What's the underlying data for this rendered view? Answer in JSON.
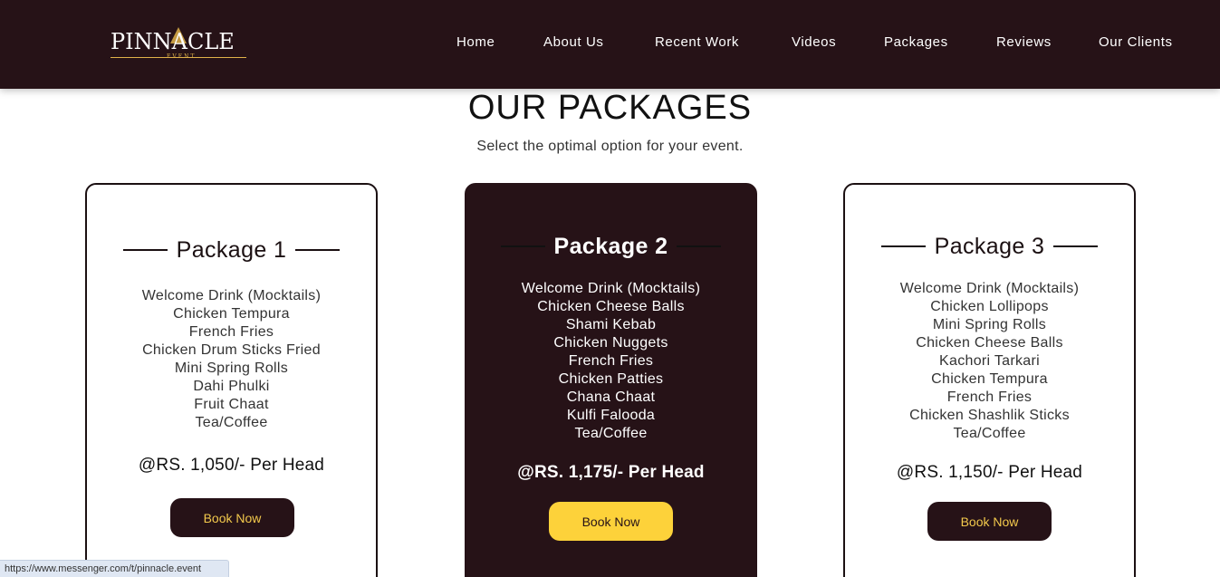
{
  "brand": {
    "logo_text": "PINNACLE",
    "logo_subtext": "EVENT"
  },
  "nav": {
    "items": [
      {
        "label": "Home"
      },
      {
        "label": "About Us"
      },
      {
        "label": "Recent Work"
      },
      {
        "label": "Videos"
      },
      {
        "label": "Packages"
      },
      {
        "label": "Reviews"
      },
      {
        "label": "Our Clients"
      }
    ]
  },
  "section": {
    "title": "OUR PACKAGES",
    "subtitle": "Select the optimal option for your event."
  },
  "packages": [
    {
      "title": "Package 1",
      "items": [
        "Welcome Drink (Mocktails)",
        "Chicken Tempura",
        "French Fries",
        "Chicken Drum Sticks Fried",
        "Mini Spring Rolls",
        "Dahi Phulki",
        "Fruit Chaat",
        "Tea/Coffee"
      ],
      "price": "@RS. 1,050/- Per Head",
      "button_label": "Book Now"
    },
    {
      "title": "Package 2",
      "items": [
        "Welcome Drink (Mocktails)",
        "Chicken Cheese Balls",
        "Shami Kebab",
        "Chicken Nuggets",
        "French Fries",
        "Chicken Patties",
        "Chana Chaat",
        "Kulfi Falooda",
        "Tea/Coffee"
      ],
      "price": "@RS. 1,175/- Per Head",
      "button_label": "Book Now"
    },
    {
      "title": "Package 3",
      "items": [
        "Welcome Drink (Mocktails)",
        "Chicken Lollipops",
        "Mini Spring Rolls",
        "Chicken Cheese Balls",
        "Kachori Tarkari",
        "Chicken Tempura",
        "French Fries",
        "Chicken Shashlik Sticks",
        "Tea/Coffee"
      ],
      "price": "@RS. 1,150/- Per Head",
      "button_label": "Book Now"
    }
  ],
  "status_bar": {
    "url": "https://www.messenger.com/t/pinnacle.event"
  },
  "colors": {
    "header_bg": "#261217",
    "accent_gold": "#e1b34a",
    "button_yellow": "#fdd23a",
    "button_dark": "#261217"
  }
}
